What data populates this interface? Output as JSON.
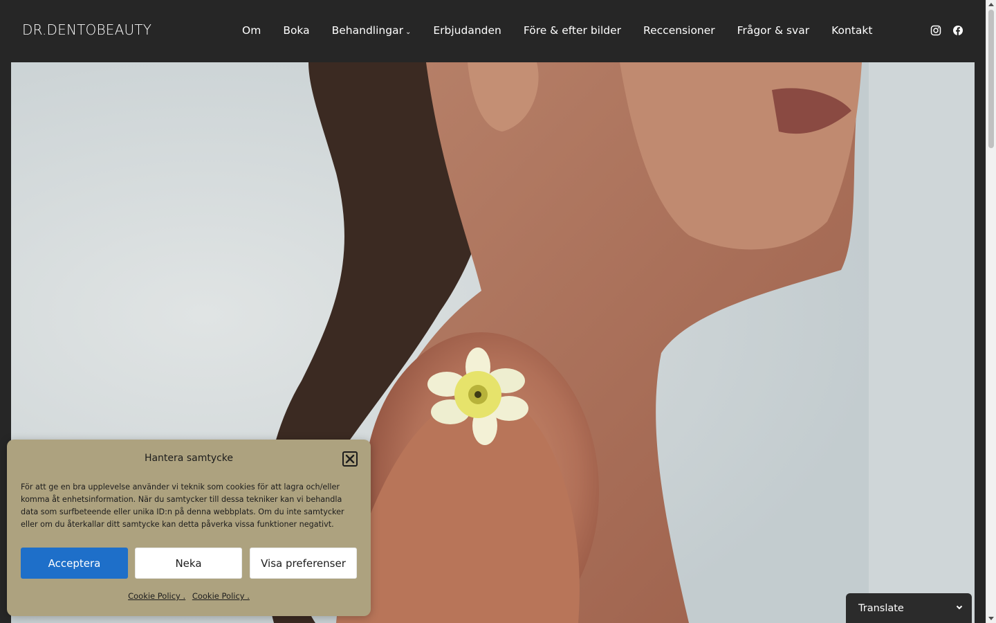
{
  "header": {
    "logo": "DR.DENTOBEAUTY",
    "nav": [
      {
        "label": "Om"
      },
      {
        "label": "Boka"
      },
      {
        "label": "Behandlingar",
        "has_dropdown": true
      },
      {
        "label": "Erbjudanden"
      },
      {
        "label": "Före & efter bilder"
      },
      {
        "label": "Reccensioner"
      },
      {
        "label": "Frågor & svar"
      },
      {
        "label": "Kontakt"
      }
    ],
    "social_icons": [
      "instagram-icon",
      "facebook-icon"
    ]
  },
  "hero": {
    "image": "woman-shoulder-yellow-flower-photo"
  },
  "cookie_banner": {
    "title": "Hantera samtycke",
    "text": "För att ge en bra upplevelse använder vi teknik som cookies för att lagra och/eller komma åt enhetsinformation. När du samtycker till dessa tekniker kan vi behandla data som surfbeteende eller unika ID:n på denna webbplats. Om du inte samtycker eller om du återkallar ditt samtycke kan detta påverka vissa funktioner negativt.",
    "accept_label": "Acceptera",
    "deny_label": "Neka",
    "prefs_label": "Visa preferenser",
    "links": [
      "Cookie Policy .",
      "Cookie Policy ."
    ]
  },
  "translate": {
    "label": "Translate"
  },
  "colors": {
    "header_bg": "#262626",
    "cookie_bg": "#ada27f",
    "accept_bg": "#1e6fc9"
  }
}
